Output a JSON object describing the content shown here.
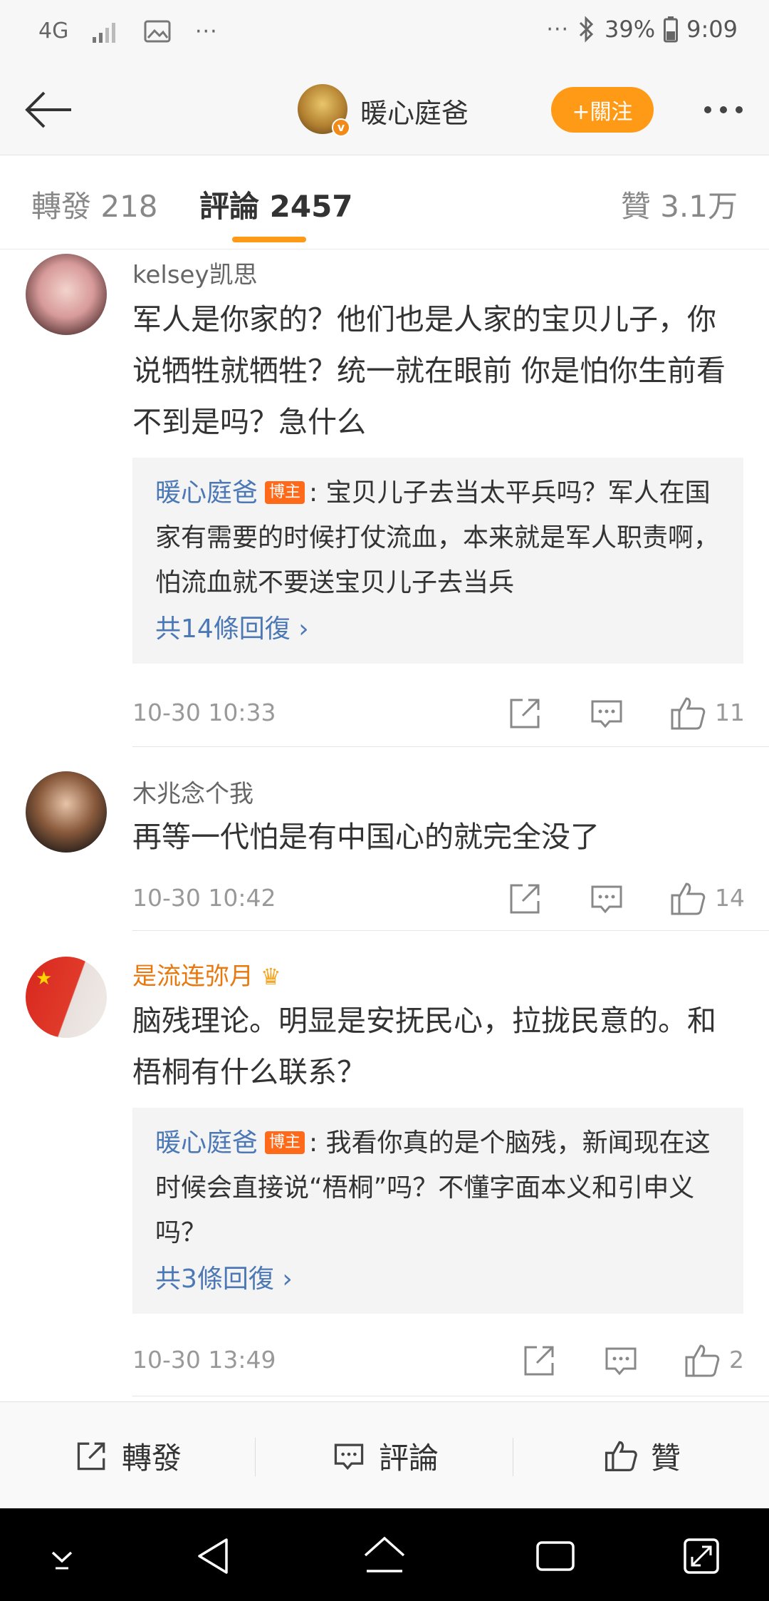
{
  "status_bar": {
    "network": "4G",
    "dots_left": "···",
    "dots_right": "···",
    "battery_percent": "39%",
    "time": "9:09"
  },
  "header": {
    "title": "暖心庭爸",
    "follow_label": "+關注"
  },
  "tabs": {
    "repost": "轉發 218",
    "comments": "評論 2457",
    "likes": "贊 3.1万"
  },
  "comments": [
    {
      "user": "kelsey凯思",
      "text": "军人是你家的？他们也是人家的宝贝儿子，你说牺牲就牺牲？统一就在眼前 你是怕你生前看不到是吗？急什么",
      "reply": {
        "author": "暖心庭爸",
        "badge": "博主",
        "text": ": 宝贝儿子去当太平兵吗？军人在国家有需要的时候打仗流血，本来就是军人职责啊，怕流血就不要送宝贝儿子去当兵",
        "more": "共14條回復 ›"
      },
      "time": "10-30 10:33",
      "likes": "11"
    },
    {
      "user": "木兆念个我",
      "text": "再等一代怕是有中国心的就完全没了",
      "time": "10-30 10:42",
      "likes": "14"
    },
    {
      "user": "是流连弥月",
      "text": "脑残理论。明显是安抚民心，拉拢民意的。和梧桐有什么联系？",
      "reply": {
        "author": "暖心庭爸",
        "badge": "博主",
        "text": ": 我看你真的是个脑残，新闻现在这时候会直接说“梧桐”吗？不懂字面本义和引申义吗？",
        "more": "共3條回復 ›"
      },
      "time": "10-30 13:49",
      "likes": "2"
    }
  ],
  "bottom_bar": {
    "repost": "轉發",
    "comment": "評論",
    "like": "贊"
  },
  "colors": {
    "accent": "#ff9a16",
    "link": "#4c79b5",
    "vip_name": "#e8790f",
    "badge": "#ff6a1a"
  }
}
